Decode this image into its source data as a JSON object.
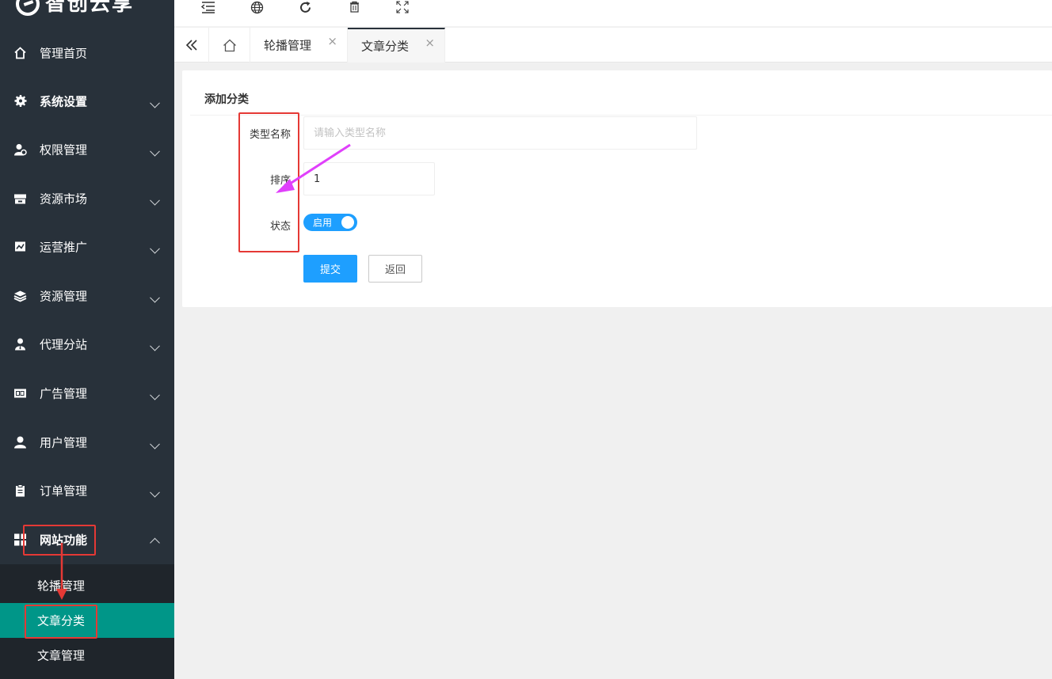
{
  "logo": {
    "text": "智创云享"
  },
  "toolbar": {
    "icons": [
      "menu-collapse-icon",
      "globe-icon",
      "refresh-icon",
      "trash-icon",
      "fullscreen-icon"
    ]
  },
  "sidebar": {
    "items": [
      {
        "label": "管理首页",
        "icon": "home-icon"
      },
      {
        "label": "系统设置",
        "icon": "gear-icon"
      },
      {
        "label": "权限管理",
        "icon": "user-lock-icon"
      },
      {
        "label": "资源市场",
        "icon": "store-icon"
      },
      {
        "label": "运营推广",
        "icon": "chart-icon"
      },
      {
        "label": "资源管理",
        "icon": "layers-icon"
      },
      {
        "label": "代理分站",
        "icon": "agent-icon"
      },
      {
        "label": "广告管理",
        "icon": "ad-icon"
      },
      {
        "label": "用户管理",
        "icon": "user-icon"
      },
      {
        "label": "订单管理",
        "icon": "clipboard-icon"
      },
      {
        "label": "网站功能",
        "icon": "grid-icon"
      }
    ],
    "submenu": [
      {
        "label": "轮播管理"
      },
      {
        "label": "文章分类",
        "active": true
      },
      {
        "label": "文章管理"
      }
    ]
  },
  "tabs": [
    {
      "label": "轮播管理",
      "close": "×"
    },
    {
      "label": "文章分类",
      "close": "×",
      "active": true
    }
  ],
  "form": {
    "title": "添加分类",
    "name_label": "类型名称",
    "name_placeholder": "请输入类型名称",
    "sort_label": "排序",
    "sort_value": "1",
    "status_label": "状态",
    "status_switch": "启用",
    "submit_label": "提交",
    "back_label": "返回"
  },
  "colors": {
    "sidebar": "#28313a",
    "active_menu": "#009688",
    "primary": "#1e9fff",
    "annotation_red": "#e53935",
    "annotation_magenta": "#e040fb"
  }
}
